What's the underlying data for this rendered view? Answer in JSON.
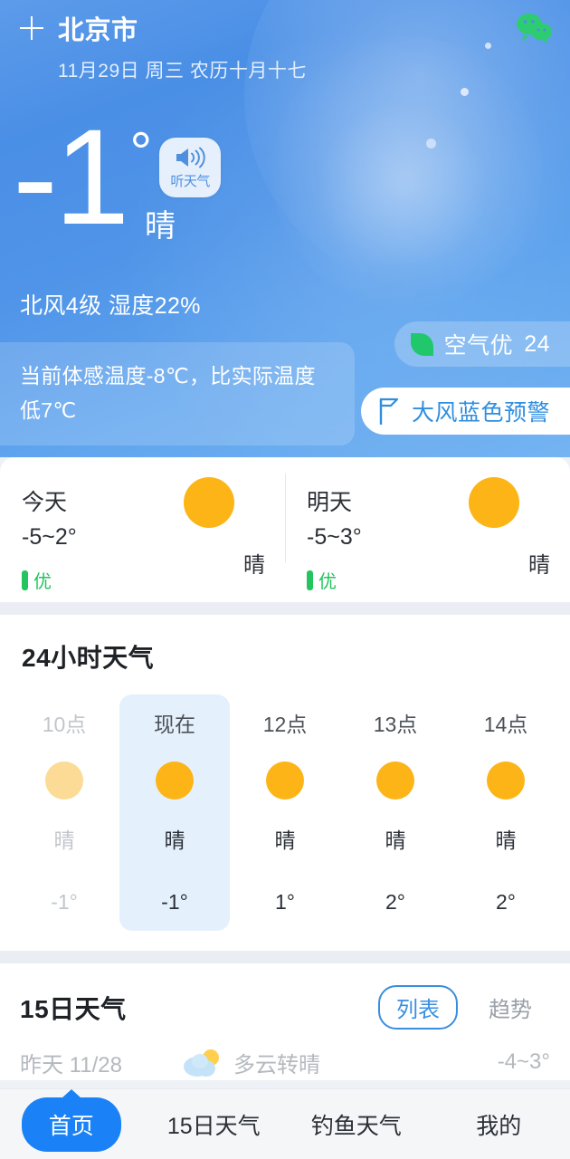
{
  "header": {
    "add_icon": "plus-icon",
    "city": "北京市",
    "date": "11月29日 周三 农历十月十七",
    "share_icon": "wechat-icon"
  },
  "current": {
    "temperature": "-1",
    "degree_symbol": "°",
    "condition": "晴",
    "listen_label": "听天气",
    "listen_icon": "speaker-icon",
    "wind_humidity": "北风4级 湿度22%",
    "feels_like": "当前体感温度-8℃，比实际温度低7℃",
    "aqi": {
      "icon": "leaf-icon",
      "label": "空气优",
      "value": "24"
    },
    "alert": {
      "icon": "flag-icon",
      "label": "大风蓝色预警"
    }
  },
  "two_day": [
    {
      "name": "今天",
      "range": "-5~2°",
      "aqi": "优",
      "condition": "晴",
      "icon": "sun-icon"
    },
    {
      "name": "明天",
      "range": "-5~3°",
      "aqi": "优",
      "condition": "晴",
      "icon": "sun-icon"
    }
  ],
  "hourly": {
    "title": "24小时天气",
    "items": [
      {
        "time": "10点",
        "condition": "晴",
        "temp": "-1°",
        "icon": "sun-icon",
        "state": "past"
      },
      {
        "time": "现在",
        "condition": "晴",
        "temp": "-1°",
        "icon": "sun-icon",
        "state": "active"
      },
      {
        "time": "12点",
        "condition": "晴",
        "temp": "1°",
        "icon": "sun-icon",
        "state": "normal"
      },
      {
        "time": "13点",
        "condition": "晴",
        "temp": "2°",
        "icon": "sun-icon",
        "state": "normal"
      },
      {
        "time": "14点",
        "condition": "晴",
        "temp": "2°",
        "icon": "sun-icon",
        "state": "normal"
      }
    ]
  },
  "fifteen_day": {
    "title": "15日天气",
    "view_list": "列表",
    "view_trend": "趋势",
    "rows": [
      {
        "day": "昨天 11/28",
        "condition": "多云转晴",
        "temp": "-4~3°",
        "icon": "cloud-sun-icon"
      }
    ]
  },
  "tabbar": [
    {
      "label": "首页",
      "active": true
    },
    {
      "label": "15日天气",
      "active": false
    },
    {
      "label": "钓鱼天气",
      "active": false
    },
    {
      "label": "我的",
      "active": false
    }
  ],
  "colors": {
    "hero_top": "#5d9bea",
    "hero_bottom": "#74b4f2",
    "accent_blue": "#1a82f6",
    "sun_yellow": "#fcb417",
    "aqi_green": "#22c55e",
    "wechat_green": "#2ecc71",
    "alert_blue": "#2f8ee0",
    "active_hour_bg": "#e4f1fc"
  }
}
